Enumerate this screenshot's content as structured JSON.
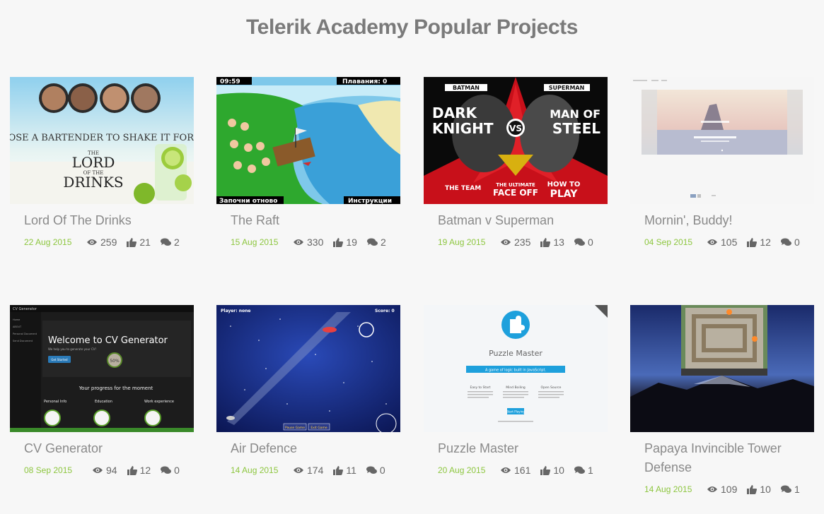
{
  "page": {
    "title": "Telerik Academy Popular Projects"
  },
  "projects": [
    {
      "title": "Lord Of The Drinks",
      "date": "22 Aug 2015",
      "views": "259",
      "likes": "21",
      "comments": "2",
      "thumb_text": {
        "headline": "CHOOSE A BARTENDER TO SHAKE IT FOR YOU",
        "logo_small": "THE",
        "logo_big1": "LORD",
        "logo_mid": "OF THE",
        "logo_big2": "DRINKS"
      }
    },
    {
      "title": "The Raft",
      "date": "15 Aug 2015",
      "views": "330",
      "likes": "19",
      "comments": "2",
      "thumb_text": {
        "timer": "09:59",
        "score": "Плавания: 0",
        "start": "Започни отново",
        "help": "Инструкции"
      }
    },
    {
      "title": "Batman v Superman",
      "date": "19 Aug 2015",
      "views": "235",
      "likes": "13",
      "comments": "0",
      "thumb_text": {
        "left_name": "BATMAN",
        "right_name": "SUPERMAN",
        "left1": "DARK",
        "left2": "KNIGHT",
        "right1": "MAN OF",
        "right2": "STEEL",
        "vs": "VS",
        "bottom_left": "THE TEAM",
        "bottom_mid1": "THE ULTIMATE",
        "bottom_mid2": "FACE OFF",
        "bottom_right1": "HOW TO",
        "bottom_right2": "PLAY"
      }
    },
    {
      "title": "Mornin', Buddy!",
      "date": "04 Sep 2015",
      "views": "105",
      "likes": "12",
      "comments": "0"
    },
    {
      "title": "CV Generator",
      "date": "08 Sep 2015",
      "views": "94",
      "likes": "12",
      "comments": "0",
      "thumb_text": {
        "brand": "CV Generator",
        "welcome": "Welcome to CV Generator",
        "sub": "We help you to generate your CV!",
        "button": "Get Started",
        "percent": "50%",
        "progress": "Your progress for the moment",
        "col1": "Personal Info",
        "col2": "Education",
        "col3": "Work experience",
        "nav1": "Home",
        "nav2": "ABOUT",
        "nav3": "Personal Document",
        "nav4": "Send Document"
      }
    },
    {
      "title": "Air Defence",
      "date": "14 Aug 2015",
      "views": "174",
      "likes": "11",
      "comments": "0",
      "thumb_text": {
        "player": "Player: none",
        "score": "Score: 0",
        "pause": "Pause Game",
        "exit": "Exit Game"
      }
    },
    {
      "title": "Puzzle Master",
      "date": "20 Aug 2015",
      "views": "161",
      "likes": "10",
      "comments": "1",
      "thumb_text": {
        "heading": "Puzzle Master",
        "banner": "A game of logic built in JavaScript.",
        "col1": "Easy to Start",
        "col2": "Mind Boiling",
        "col3": "Open Source",
        "button": "Start Playing"
      }
    },
    {
      "title": "Papaya Invincible Tower Defense",
      "date": "14 Aug 2015",
      "views": "109",
      "likes": "10",
      "comments": "1"
    }
  ],
  "icons": {
    "views": "eye-icon",
    "likes": "thumbs-up-icon",
    "comments": "comments-icon"
  },
  "colors": {
    "date": "#8dc63f",
    "title": "#7a7a7a",
    "card_title": "#8a8a8a",
    "background": "#f7f7f7"
  }
}
